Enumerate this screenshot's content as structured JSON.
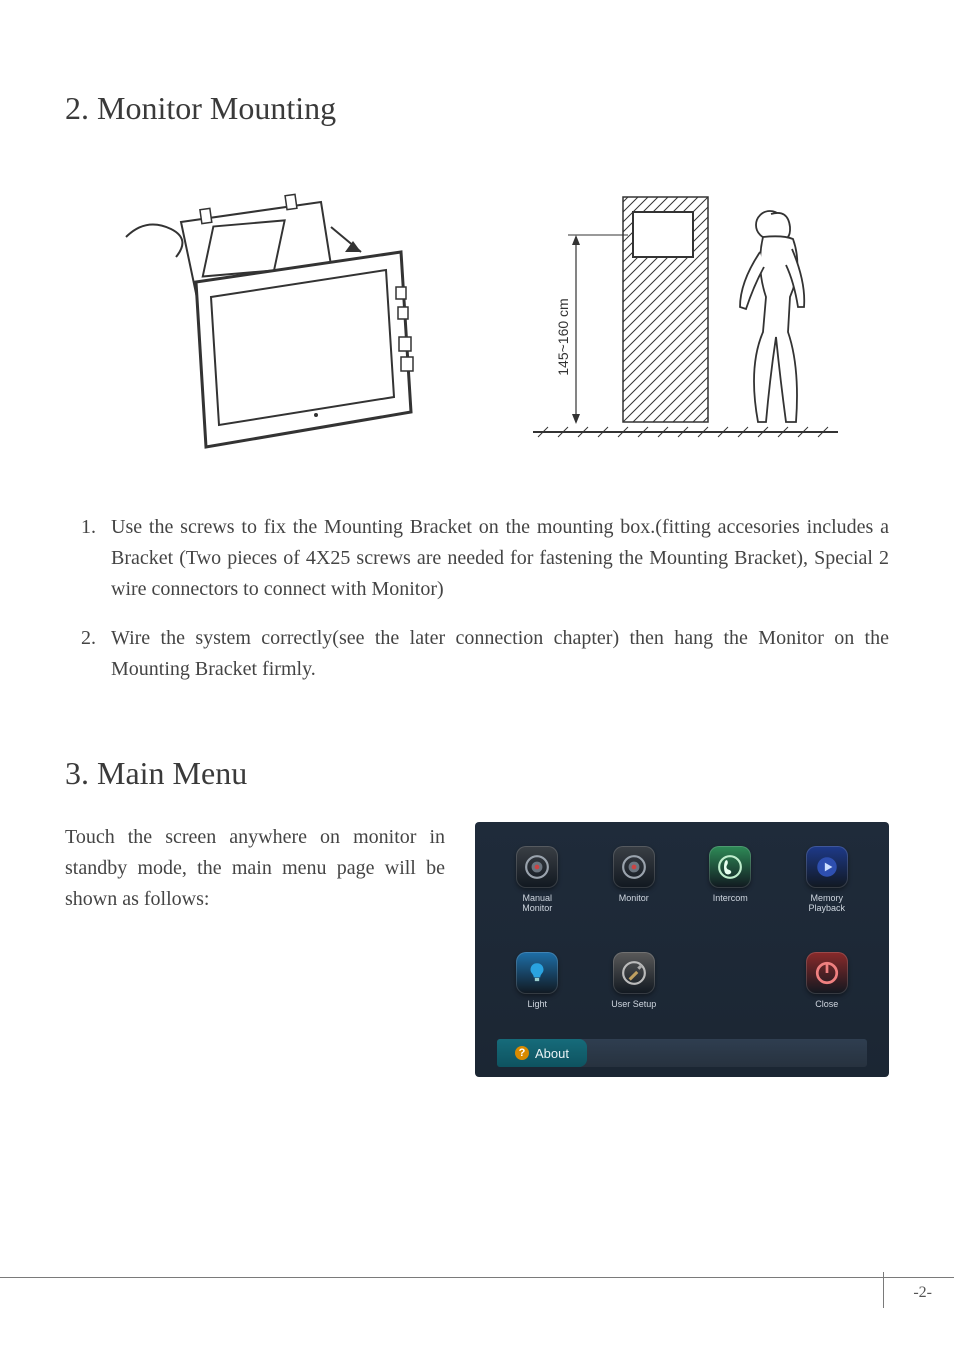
{
  "section2": {
    "title": "2. Monitor Mounting",
    "height_label": "145~160 cm",
    "steps": [
      "Use the screws to fix the Mounting Bracket on the mounting box.(fitting accesories includes a Bracket (Two pieces of 4X25 screws are needed for fastening the Mounting Bracket), Special 2 wire connectors to connect with Monitor)",
      "Wire the system correctly(see the later connection chapter) then hang the Monitor on the Mounting Bracket firmly."
    ]
  },
  "section3": {
    "title": "3. Main Menu",
    "intro": "Touch the screen anywhere on monitor in standby mode, the main menu page will be shown as follows:",
    "menu": {
      "icons": [
        {
          "name": "manual-monitor",
          "label": "Manual\nMonitor",
          "color": "#3a3f45",
          "glyph": "camera"
        },
        {
          "name": "monitor",
          "label": "Monitor",
          "color": "#3a3f45",
          "glyph": "camera"
        },
        {
          "name": "intercom",
          "label": "Intercom",
          "color": "#2e8b57",
          "glyph": "phone"
        },
        {
          "name": "memory-playback",
          "label": "Memory\nPlayback",
          "color": "#1e3a8a",
          "glyph": "play"
        },
        {
          "name": "light",
          "label": "Light",
          "color": "#1e6fa8",
          "glyph": "bulb"
        },
        {
          "name": "user-setup",
          "label": "User Setup",
          "color": "#5a5a5a",
          "glyph": "tools"
        },
        {
          "name": "",
          "label": "",
          "color": "",
          "glyph": ""
        },
        {
          "name": "close",
          "label": "Close",
          "color": "#8a2a2a",
          "glyph": "power"
        }
      ],
      "about_label": "About"
    }
  },
  "page_number": "-2-"
}
